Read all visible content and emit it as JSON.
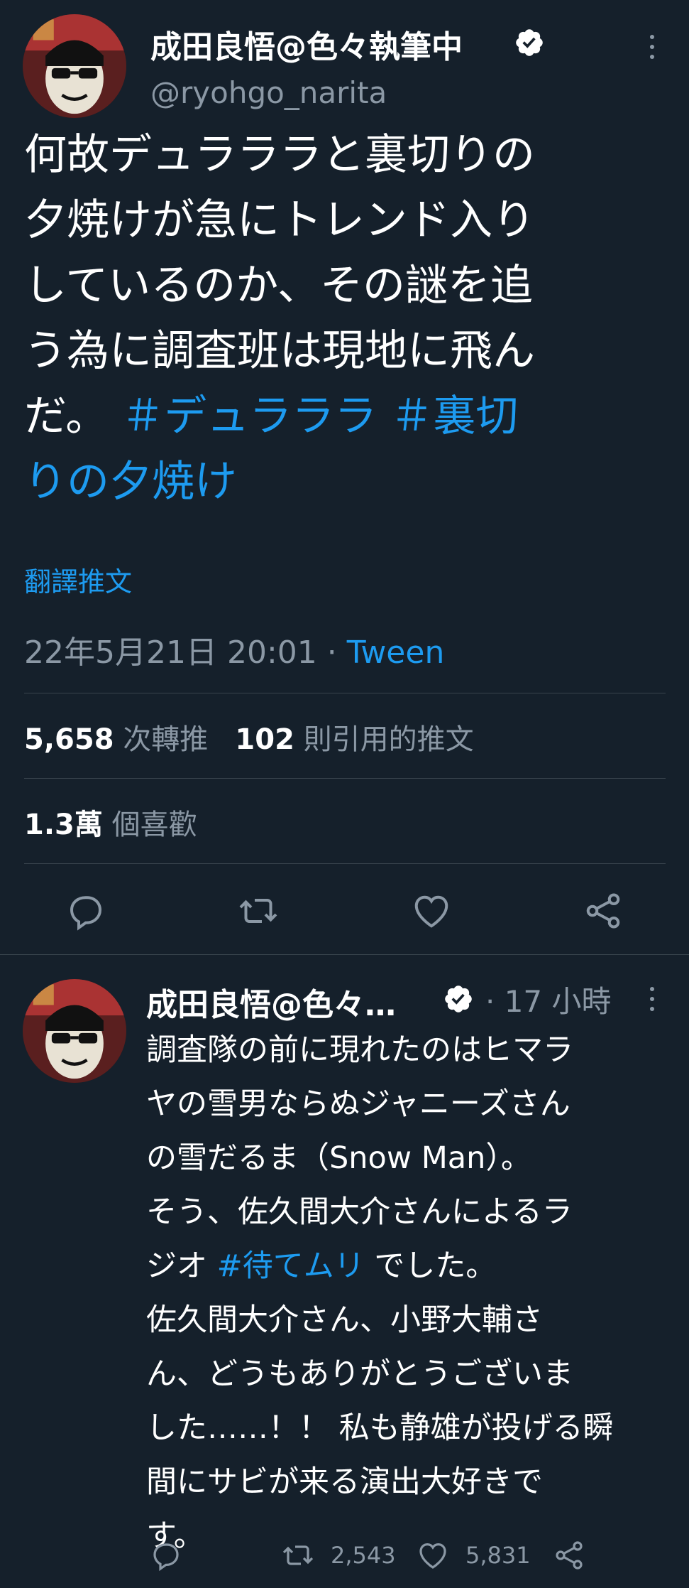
{
  "main_tweet": {
    "author_name": "成田良悟@色々執筆中",
    "handle": "@ryohgo_narita",
    "text_lines": [
      "何故デュラララと裏切りの",
      "夕焼けが急にトレンド入り",
      "しているのか、その謎を追",
      "う為に調査班は現地に飛ん",
      "だ。"
    ],
    "hashtag_1": "＃デュラララ",
    "hashtag_2_part_a": "＃裏切",
    "hashtag_2_part_b": "りの夕焼け",
    "translate_label": "翻譯推文",
    "timestamp": "22年5月21日 20:01 · ",
    "source": "Tween",
    "retweets_count": "5,658",
    "retweets_label": "次轉推",
    "quotes_count": "102",
    "quotes_label": "則引用的推文",
    "likes_count": "1.3萬",
    "likes_label": "個喜歡"
  },
  "reply_tweet": {
    "author_name": "成田良悟@色々…",
    "time": "· 17 小時",
    "text_before_tag": [
      "調査隊の前に現れたのはヒマラ",
      "ヤの雪男ならぬジャニーズさん",
      "の雪だるま（Snow Man）。",
      "そう、佐久間大介さんによるラ"
    ],
    "tag_line_prefix": "ジオ ",
    "hashtag": "#待てムリ",
    "tag_line_suffix": " でした。",
    "text_after_tag": [
      "佐久間大介さん、小野大輔さ",
      "ん、どうもありがとうございま",
      "した……！！ 私も静雄が投げる瞬",
      "間にサビが来る演出大好きで",
      "す。"
    ],
    "retweets": "2,543",
    "likes": "5,831"
  },
  "colors": {
    "background": "#15202b",
    "accent": "#1d9bf0",
    "muted": "#8b98a5",
    "divider": "#38444d"
  },
  "icons": [
    "verified-badge-icon",
    "more-icon",
    "reply-icon",
    "retweet-icon",
    "like-icon",
    "share-icon"
  ]
}
